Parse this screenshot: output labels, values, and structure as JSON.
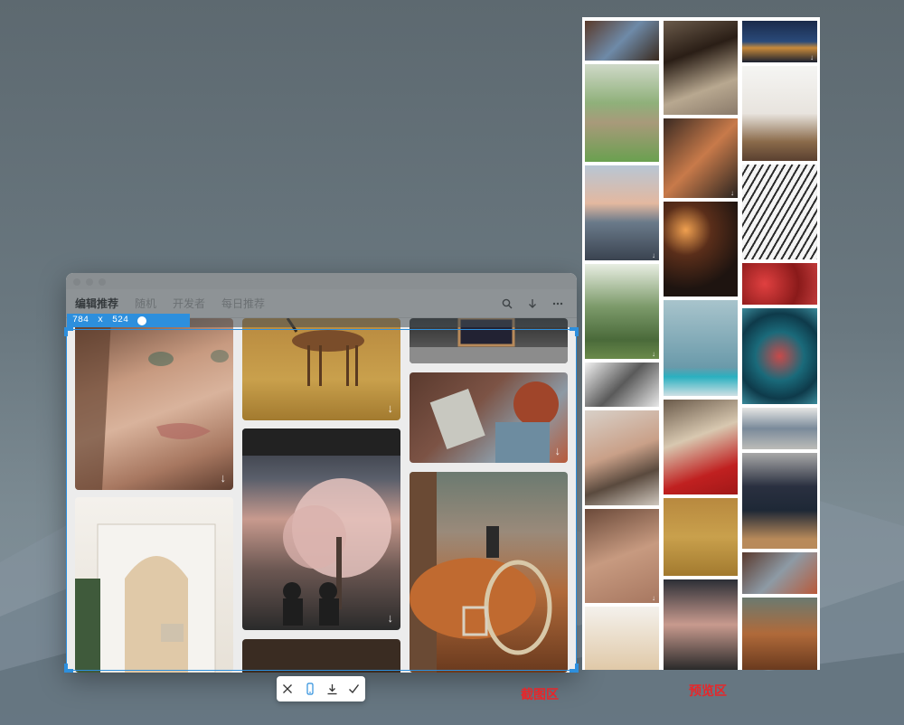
{
  "app": {
    "tabs": [
      {
        "label": "编辑推荐",
        "active": true
      },
      {
        "label": "随机",
        "active": false
      },
      {
        "label": "开发者",
        "active": false
      },
      {
        "label": "每日推荐",
        "active": false
      }
    ],
    "icons": [
      "search-icon",
      "download-icon",
      "more-icon"
    ]
  },
  "capture": {
    "width": "784",
    "separator": "x",
    "height": "524",
    "accent_color": "#2d8fdd"
  },
  "actions": [
    {
      "name": "cancel-button",
      "icon": "close-icon"
    },
    {
      "name": "mobile-button",
      "icon": "phone-icon"
    },
    {
      "name": "save-button",
      "icon": "download-icon"
    },
    {
      "name": "confirm-button",
      "icon": "check-icon"
    }
  ],
  "labels": {
    "capture_area": "截图区",
    "preview_area": "预览区",
    "label_color": "#e8262a"
  },
  "download_glyph": "↓"
}
